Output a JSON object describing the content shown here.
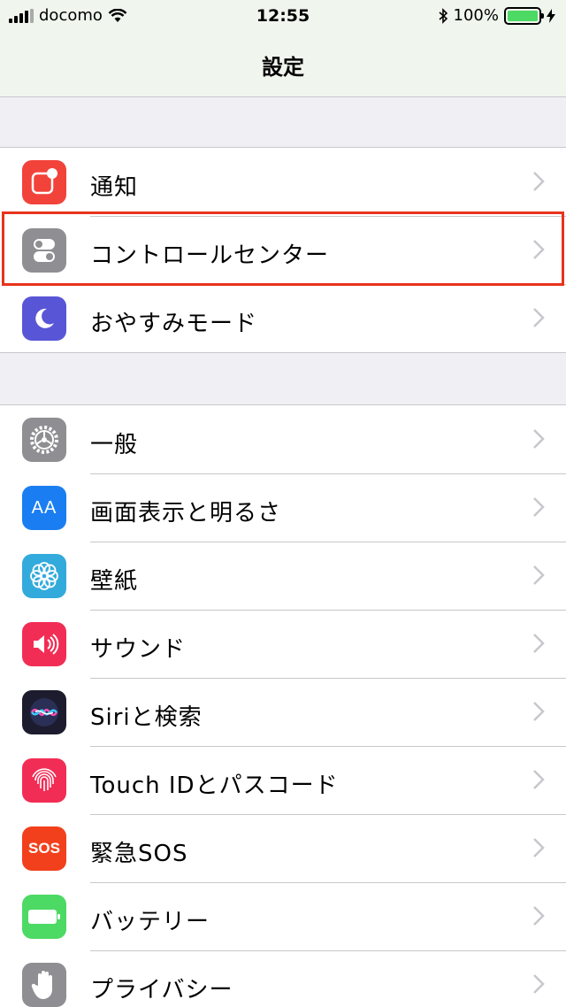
{
  "status": {
    "carrier": "docomo",
    "time": "12:55",
    "battery": "100%"
  },
  "nav": {
    "title": "設定"
  },
  "groups": [
    {
      "items": [
        {
          "label": "通知",
          "icon": "notifications-icon",
          "color": "#f2433a"
        },
        {
          "label": "コントロールセンター",
          "icon": "control-center-icon",
          "color": "#8e8e93"
        },
        {
          "label": "おやすみモード",
          "icon": "moon-icon",
          "color": "#5856d6"
        }
      ]
    },
    {
      "items": [
        {
          "label": "一般",
          "icon": "gear-icon",
          "color": "#8e8e93"
        },
        {
          "label": "画面表示と明るさ",
          "icon": "display-icon",
          "color": "#1a7ef2"
        },
        {
          "label": "壁紙",
          "icon": "wallpaper-icon",
          "color": "#33aadc"
        },
        {
          "label": "サウンド",
          "icon": "sound-icon",
          "color": "#f22d55"
        },
        {
          "label": "Siriと検索",
          "icon": "siri-icon",
          "color": "#1c1c2e"
        },
        {
          "label": "Touch IDとパスコード",
          "icon": "fingerprint-icon",
          "color": "#f22d55"
        },
        {
          "label": "緊急SOS",
          "icon": "sos-icon",
          "color": "#f2401c"
        },
        {
          "label": "バッテリー",
          "icon": "battery-icon",
          "color": "#4cd964"
        },
        {
          "label": "プライバシー",
          "icon": "privacy-hand-icon",
          "color": "#8e8e93"
        }
      ]
    }
  ],
  "sos_text": "SOS",
  "display_text": "AA"
}
